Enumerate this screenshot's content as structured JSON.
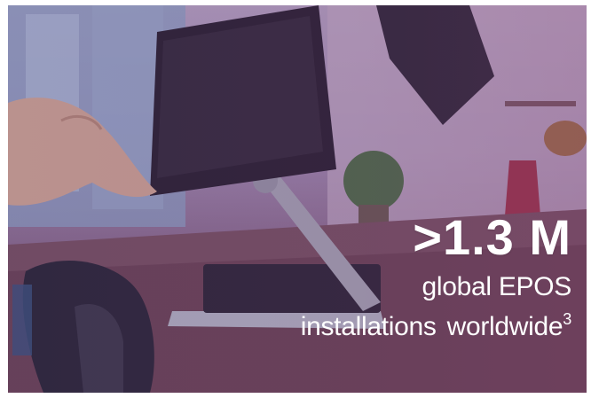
{
  "stat": {
    "value": ">1.3 M",
    "line1": "global EPOS",
    "line2_a": "installations",
    "line2_b": "worldwide",
    "footnote": "3"
  },
  "colors": {
    "tint": "#7a4f86",
    "text": "#ffffff"
  }
}
